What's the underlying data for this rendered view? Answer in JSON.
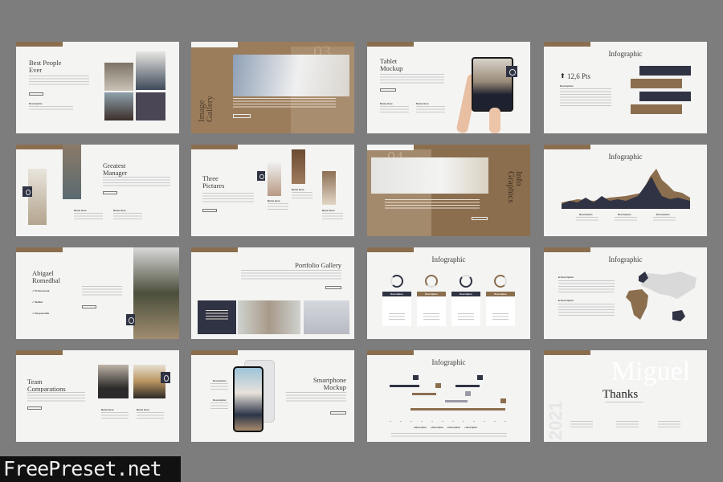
{
  "colors": {
    "background": "#7d7d7d",
    "slide": "#f4f4f3",
    "brown": "#8b6e4e",
    "navy": "#2f3344"
  },
  "slides": [
    {
      "title": "Best People\nEver",
      "description": "Description"
    },
    {
      "title": "Image\nGallery",
      "number": "03"
    },
    {
      "title": "Tablet\nMockup",
      "names": [
        "Name Here",
        "Name Here"
      ]
    },
    {
      "title": "Infographic",
      "stat": "12,6 Pts",
      "stat_icon": "arrow-up-icon",
      "description": "Description"
    },
    {
      "title": "Greatest\nManager",
      "names": [
        "Name Here",
        "Name Here"
      ]
    },
    {
      "title": "Three\nPictures",
      "names": [
        "Name Here",
        "Name Here",
        "Name Here"
      ]
    },
    {
      "title": "Info\nGraphics",
      "number": "04"
    },
    {
      "title": "Infographic",
      "chart_type": "area",
      "descriptions": [
        "Description",
        "Description",
        "Description"
      ]
    },
    {
      "title": "Abigael\nRomedhal",
      "traits": [
        "Professional",
        "Skilled",
        "Responsible"
      ]
    },
    {
      "title": "Portfolio Gallery"
    },
    {
      "title": "Infographic",
      "cards": [
        "Description",
        "Description",
        "Description",
        "Description"
      ]
    },
    {
      "title": "Infographic",
      "descriptions": [
        "Description",
        "Description"
      ]
    },
    {
      "title": "Team\nComparations",
      "names": [
        "Name Here",
        "Name Here"
      ]
    },
    {
      "title": "Smartphone\nMockup",
      "descriptions": [
        "Description",
        "Description"
      ]
    },
    {
      "title": "Infographic",
      "legend": [
        "Description",
        "Description",
        "Description",
        "Description"
      ]
    },
    {
      "title": "Thanks",
      "background_word": "Miguel",
      "year": "2021"
    }
  ],
  "watermark": "FreePreset.net"
}
